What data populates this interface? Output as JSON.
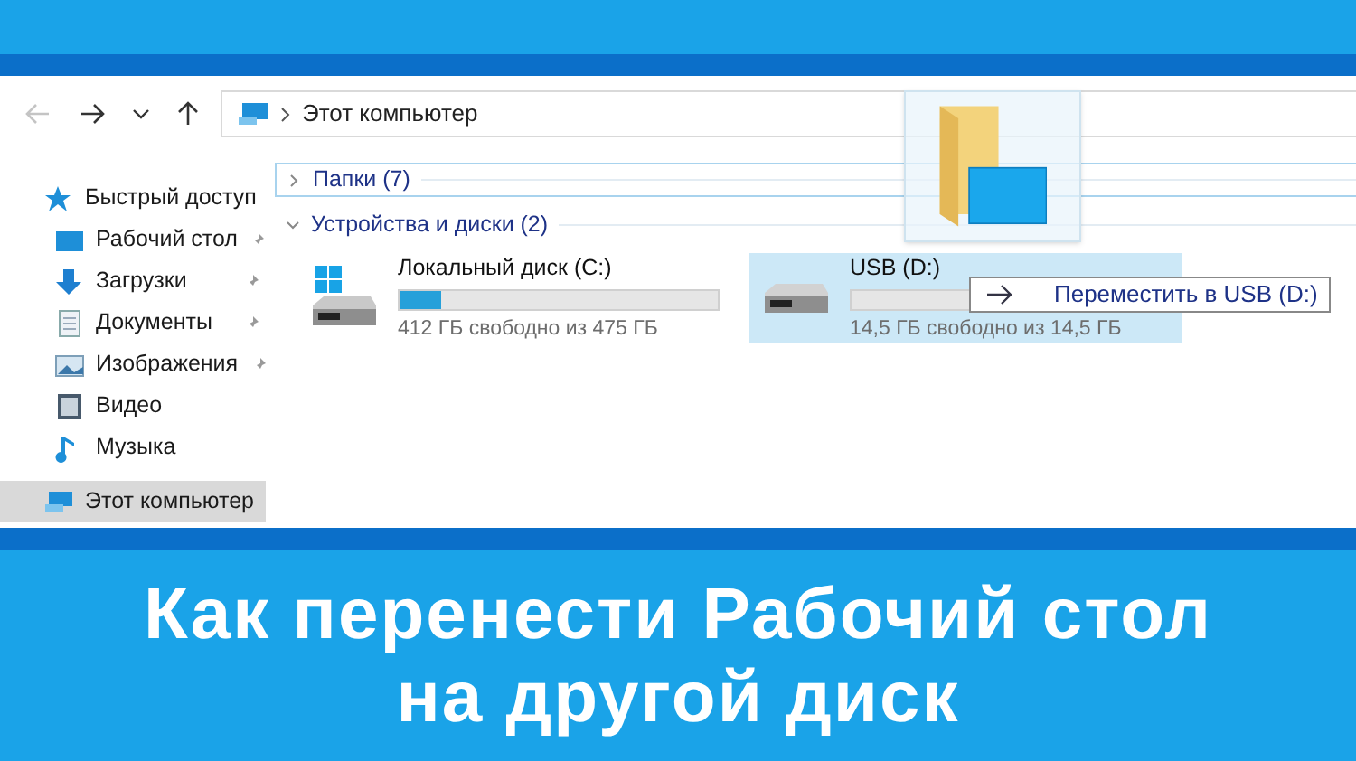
{
  "nav": {
    "buttons": [
      {
        "kind": "back",
        "disabled": true
      },
      {
        "kind": "forward",
        "disabled": false
      },
      {
        "kind": "recent",
        "disabled": false
      },
      {
        "kind": "up",
        "disabled": false
      }
    ],
    "address": "Этот компьютер"
  },
  "sidebar": {
    "items": [
      {
        "label": "Быстрый доступ",
        "kind": "star",
        "pinned": false,
        "selected": false
      },
      {
        "label": "Рабочий стол",
        "kind": "desktop",
        "pinned": true,
        "selected": false
      },
      {
        "label": "Загрузки",
        "kind": "download",
        "pinned": true,
        "selected": false
      },
      {
        "label": "Документы",
        "kind": "document",
        "pinned": true,
        "selected": false
      },
      {
        "label": "Изображения",
        "kind": "image",
        "pinned": true,
        "selected": false
      },
      {
        "label": "Видео",
        "kind": "video",
        "pinned": false,
        "selected": false
      },
      {
        "label": "Музыка",
        "kind": "music",
        "pinned": false,
        "selected": false
      },
      {
        "label": "Этот компьютер",
        "kind": "computer",
        "pinned": false,
        "selected": true
      }
    ]
  },
  "groups": [
    {
      "label": "Папки (7)",
      "expanded": false
    },
    {
      "label": "Устройства и диски (2)",
      "expanded": true
    }
  ],
  "drives": [
    {
      "name": "Локальный диск (C:)",
      "kind": "system",
      "level": 0.13,
      "free": "412 ГБ свободно из 475 ГБ",
      "selected": false
    },
    {
      "name": "USB (D:)",
      "kind": "removable",
      "level": 0,
      "free": "14,5 ГБ свободно из 14,5 ГБ",
      "selected": true
    }
  ],
  "drag": {
    "tooltip": "Переместить в USB (D:)"
  },
  "title": {
    "lines": [
      "Как перенести Рабочий стол",
      "на другой диск"
    ]
  }
}
